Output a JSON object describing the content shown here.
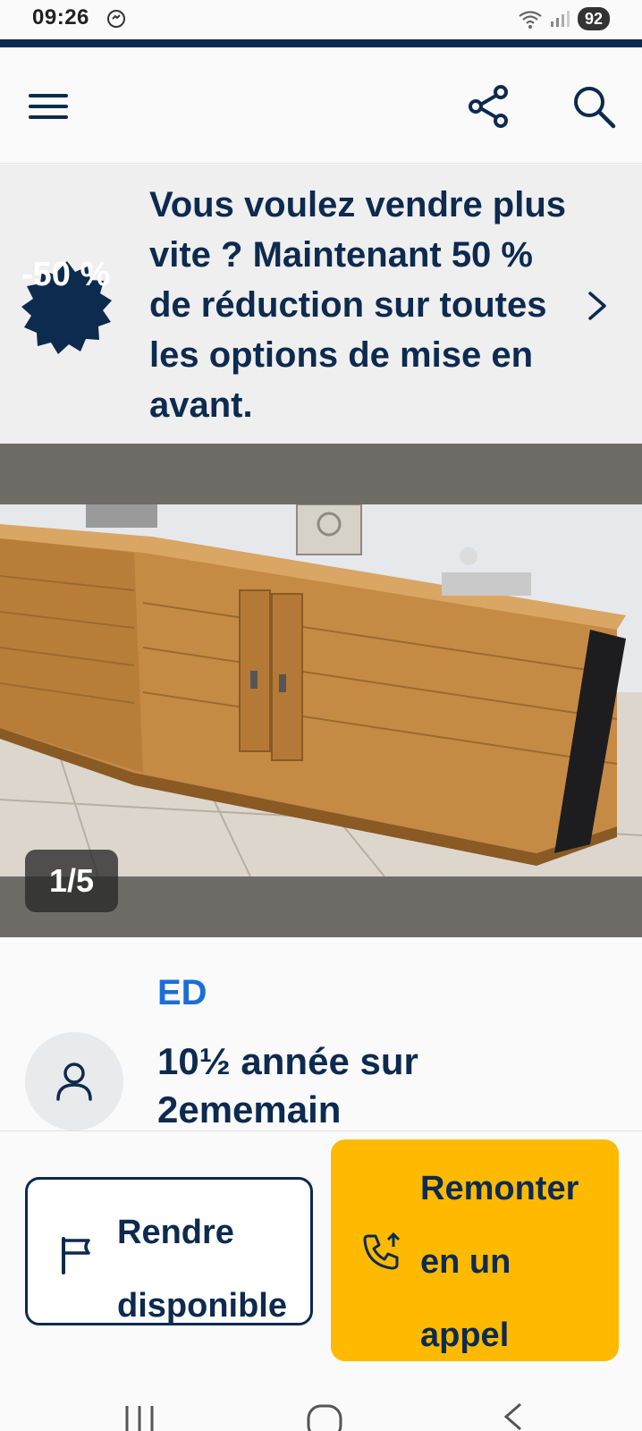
{
  "status_bar": {
    "time": "09:26",
    "battery": "92",
    "icons": [
      "messenger-icon",
      "wifi-icon",
      "signal-icon",
      "battery-icon"
    ]
  },
  "header": {
    "icons": [
      "menu-icon",
      "share-icon",
      "search-icon"
    ]
  },
  "promo": {
    "badge_text": "-50 %",
    "text": "Vous voulez vendre plus vite ? Maintenant 50 % de réduction sur toutes les options de mise en avant.",
    "chevron_icon": "chevron-right-icon"
  },
  "gallery": {
    "counter": "1/5",
    "current_index": 1,
    "total": 5
  },
  "seller": {
    "name": "ED",
    "tenure": "10½ année sur 2ememain",
    "avatar_icon": "user-icon"
  },
  "actions": {
    "available_label": "Rendre disponible",
    "available_icon": "flag-icon",
    "boost_label": "Remonter en un appel",
    "boost_icon": "phone-up-icon"
  },
  "colors": {
    "navy": "#0d2a4f",
    "link_blue": "#1a6fd6",
    "accent_yellow": "#ffba00",
    "gallery_bg": "#6e6c67"
  },
  "system_nav": {
    "icons": [
      "recent-apps-icon",
      "home-icon",
      "back-icon"
    ]
  }
}
